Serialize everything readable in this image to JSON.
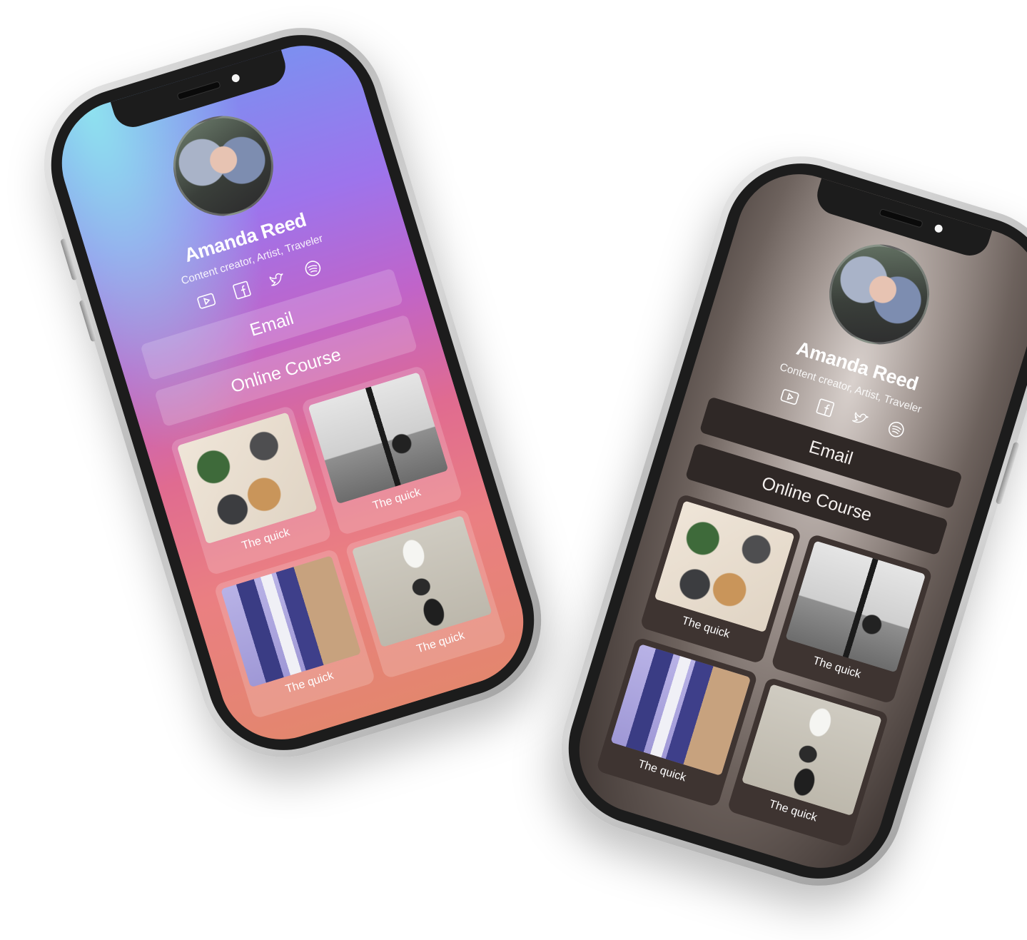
{
  "profile": {
    "name": "Amanda Reed",
    "tagline": "Content creator,  Artist, Traveler"
  },
  "socials": [
    {
      "icon": "youtube-icon"
    },
    {
      "icon": "facebook-icon"
    },
    {
      "icon": "twitter-icon"
    },
    {
      "icon": "spotify-icon"
    }
  ],
  "links": {
    "email": "Email",
    "online_course": "Online Course"
  },
  "cards": [
    {
      "label": "The quick"
    },
    {
      "label": "The quick"
    },
    {
      "label": "The quick"
    },
    {
      "label": "The quick"
    }
  ],
  "themes": {
    "gradient_phone": {
      "top": "#7d8ff0",
      "middle": "#c064c9",
      "bottom": "#e3866e"
    },
    "dark_phone": {
      "background": "#6d625d",
      "button": "#2f2826"
    }
  }
}
